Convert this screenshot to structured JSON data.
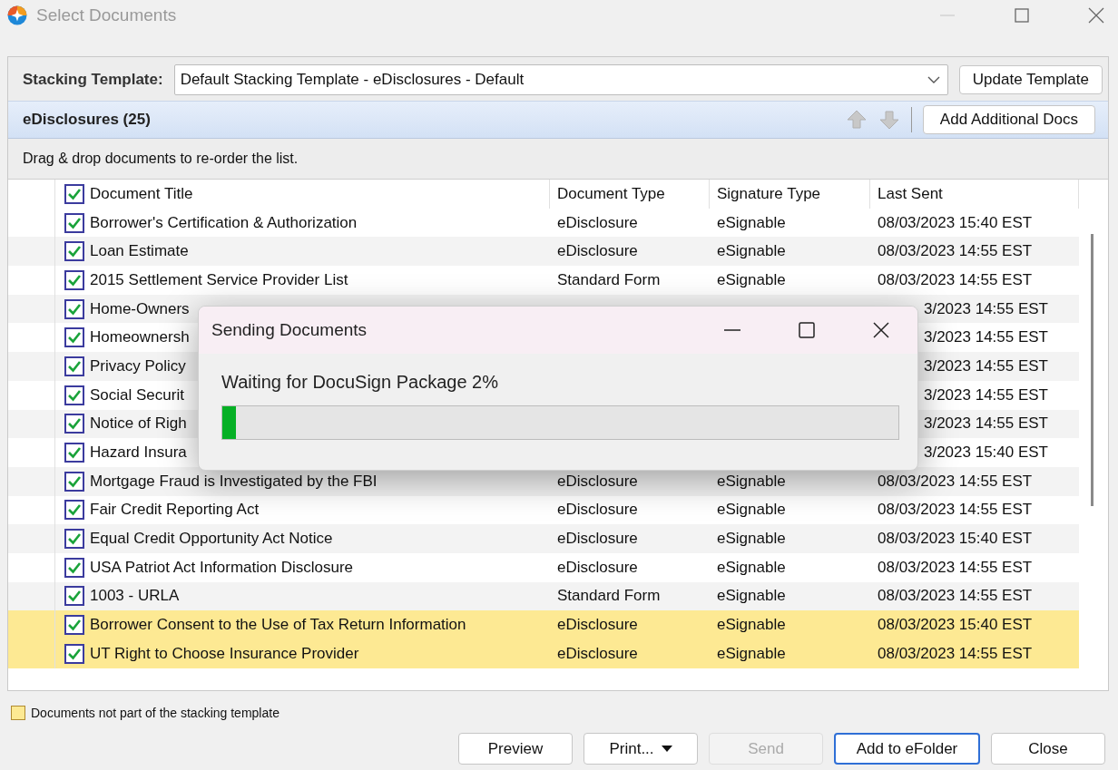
{
  "window": {
    "title": "Select Documents"
  },
  "stacking_template": {
    "label": "Stacking Template:",
    "value": "Default Stacking Template - eDisclosures - Default",
    "button": "Update Template"
  },
  "section": {
    "title": "eDisclosures (25)",
    "button": "Add Additional Docs"
  },
  "hint": "Drag & drop documents to re-order the list.",
  "table": {
    "header": {
      "checked": true,
      "columns": [
        "Document Title",
        "Document Type",
        "Signature Type",
        "Last Sent"
      ]
    },
    "rows": [
      {
        "checked": true,
        "highlighted": false,
        "title": "Borrower's Certification & Authorization",
        "document_type": "eDisclosure",
        "signature_type": "eSignable",
        "last_sent": "08/03/2023 15:40 EST"
      },
      {
        "checked": true,
        "highlighted": false,
        "title": "Loan Estimate",
        "document_type": "eDisclosure",
        "signature_type": "eSignable",
        "last_sent": "08/03/2023 14:55 EST"
      },
      {
        "checked": true,
        "highlighted": false,
        "title": "2015 Settlement Service Provider List",
        "document_type": "Standard Form",
        "signature_type": "eSignable",
        "last_sent": "08/03/2023 14:55 EST"
      },
      {
        "checked": true,
        "highlighted": false,
        "title": "Home-Owners",
        "last_sent": "3/2023 14:55 EST"
      },
      {
        "checked": true,
        "highlighted": false,
        "title": "Homeownersh",
        "last_sent": "3/2023 14:55 EST"
      },
      {
        "checked": true,
        "highlighted": false,
        "title": "Privacy Policy",
        "last_sent": "3/2023 14:55 EST"
      },
      {
        "checked": true,
        "highlighted": false,
        "title": "Social Securit",
        "last_sent": "3/2023 14:55 EST"
      },
      {
        "checked": true,
        "highlighted": false,
        "title": "Notice of Righ",
        "last_sent": "3/2023 14:55 EST"
      },
      {
        "checked": true,
        "highlighted": false,
        "title": "Hazard Insura",
        "last_sent": "3/2023 15:40 EST"
      },
      {
        "checked": true,
        "highlighted": false,
        "title": "Mortgage Fraud is Investigated by the FBI",
        "document_type": "eDisclosure",
        "signature_type": "eSignable",
        "last_sent": "08/03/2023 14:55 EST"
      },
      {
        "checked": true,
        "highlighted": false,
        "title": "Fair Credit Reporting Act",
        "document_type": "eDisclosure",
        "signature_type": "eSignable",
        "last_sent": "08/03/2023 14:55 EST"
      },
      {
        "checked": true,
        "highlighted": false,
        "title": "Equal Credit Opportunity Act Notice",
        "document_type": "eDisclosure",
        "signature_type": "eSignable",
        "last_sent": "08/03/2023 15:40 EST"
      },
      {
        "checked": true,
        "highlighted": false,
        "title": "USA Patriot Act Information Disclosure",
        "document_type": "eDisclosure",
        "signature_type": "eSignable",
        "last_sent": "08/03/2023 14:55 EST"
      },
      {
        "checked": true,
        "highlighted": false,
        "title": "1003 - URLA",
        "document_type": "Standard Form",
        "signature_type": "eSignable",
        "last_sent": "08/03/2023 14:55 EST"
      },
      {
        "checked": true,
        "highlighted": true,
        "title": "Borrower Consent to the Use of Tax Return Information",
        "document_type": "eDisclosure",
        "signature_type": "eSignable",
        "last_sent": "08/03/2023 15:40 EST"
      },
      {
        "checked": true,
        "highlighted": true,
        "title": "UT Right to Choose Insurance Provider",
        "document_type": "eDisclosure",
        "signature_type": "eSignable",
        "last_sent": "08/03/2023 14:55 EST"
      }
    ]
  },
  "legend": {
    "label": "Documents not part of the stacking template"
  },
  "buttons": [
    {
      "label": "Preview",
      "kind": "plain",
      "disabled": false,
      "focused": false
    },
    {
      "label": "Print...",
      "kind": "dropdown",
      "disabled": false,
      "focused": false
    },
    {
      "label": "Send",
      "kind": "plain",
      "disabled": true,
      "focused": false
    },
    {
      "label": "Add to eFolder",
      "kind": "plain",
      "disabled": false,
      "focused": true
    },
    {
      "label": "Close",
      "kind": "plain",
      "disabled": false,
      "focused": false
    }
  ],
  "dialog": {
    "title": "Sending Documents",
    "message": "Waiting for DocuSign Package 2%",
    "level": 0.02
  }
}
